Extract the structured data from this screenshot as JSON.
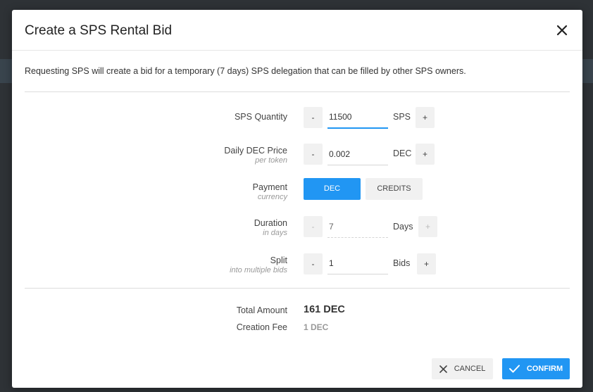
{
  "modal": {
    "title": "Create a SPS Rental Bid",
    "description": "Requesting SPS will create a bid for a temporary (7 days) SPS delegation that can be filled by other SPS owners."
  },
  "form": {
    "quantity": {
      "label": "SPS Quantity",
      "value": "11500",
      "unit": "SPS",
      "minus": "-",
      "plus": "+"
    },
    "price": {
      "label": "Daily DEC Price",
      "sublabel": "per token",
      "value": "0.002",
      "unit": "DEC",
      "minus": "-",
      "plus": "+"
    },
    "payment": {
      "label": "Payment",
      "sublabel": "currency",
      "options": [
        "DEC",
        "CREDITS"
      ],
      "selected": "DEC"
    },
    "duration": {
      "label": "Duration",
      "sublabel": "in days",
      "value": "7",
      "unit": "Days",
      "minus": "-",
      "plus": "+"
    },
    "split": {
      "label": "Split",
      "sublabel": "into multiple bids",
      "value": "1",
      "unit": "Bids",
      "minus": "-",
      "plus": "+"
    }
  },
  "summary": {
    "total_label": "Total Amount",
    "total_value": "161 DEC",
    "fee_label": "Creation Fee",
    "fee_value": "1 DEC"
  },
  "footer": {
    "cancel_label": "CANCEL",
    "confirm_label": "CONFIRM"
  },
  "icons": {
    "close": "close-icon",
    "cancel": "x-icon",
    "confirm": "checkmark-icon"
  },
  "colors": {
    "accent": "#2196f3",
    "backdrop": "#2e3236"
  }
}
